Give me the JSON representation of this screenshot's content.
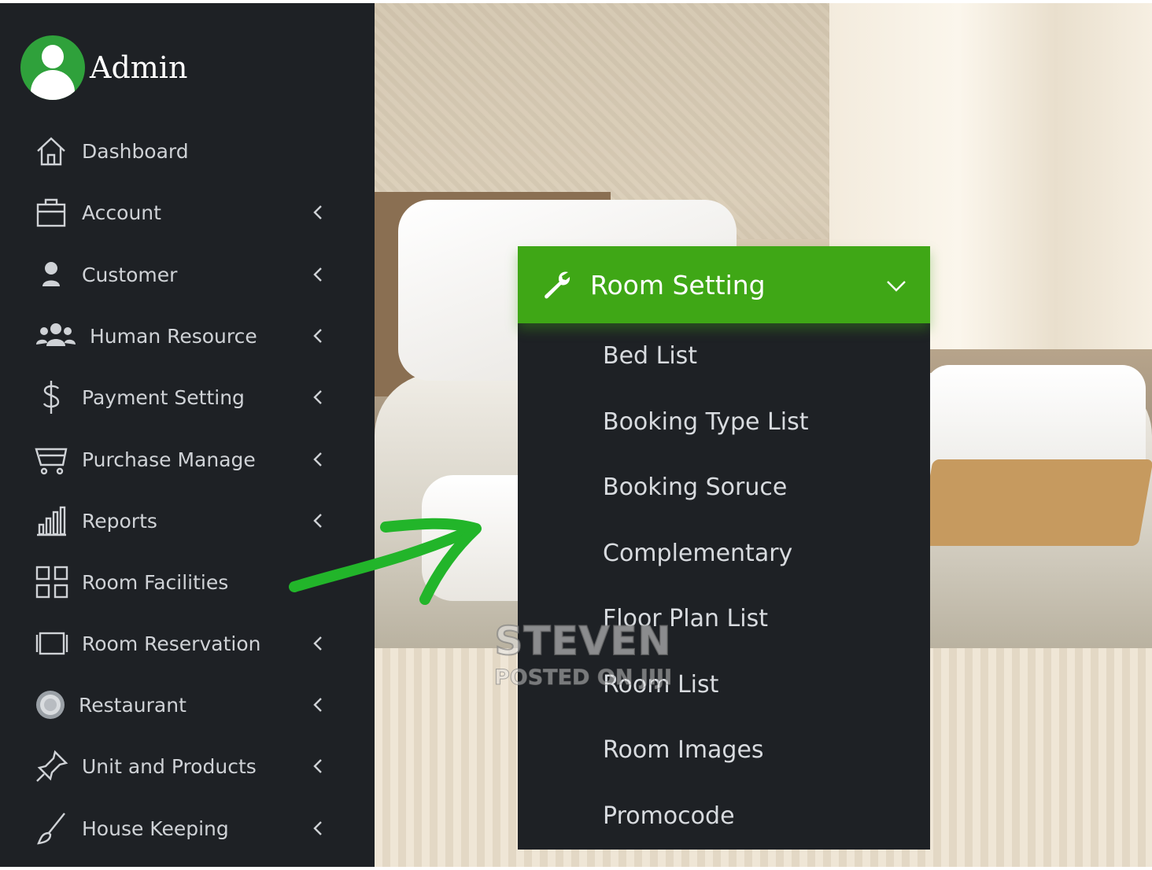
{
  "admin": {
    "name": "Admin"
  },
  "sidebar": {
    "items": [
      {
        "label": "Dashboard",
        "icon": "home-icon",
        "has_submenu": false
      },
      {
        "label": "Account",
        "icon": "briefcase-icon",
        "has_submenu": true
      },
      {
        "label": "Customer",
        "icon": "user-icon",
        "has_submenu": true
      },
      {
        "label": "Human Resource",
        "icon": "users-icon",
        "has_submenu": true
      },
      {
        "label": "Payment Setting",
        "icon": "dollar-icon",
        "has_submenu": true
      },
      {
        "label": "Purchase Manage",
        "icon": "cart-icon",
        "has_submenu": true
      },
      {
        "label": "Reports",
        "icon": "bar-chart-icon",
        "has_submenu": true
      },
      {
        "label": "Room Facilities",
        "icon": "grid-icon",
        "has_submenu": false
      },
      {
        "label": "Room Reservation",
        "icon": "panel-icon",
        "has_submenu": true
      },
      {
        "label": "Restaurant",
        "icon": "plate-icon",
        "has_submenu": true
      },
      {
        "label": "Unit and Products",
        "icon": "pin-icon",
        "has_submenu": true
      },
      {
        "label": "House Keeping",
        "icon": "brush-icon",
        "has_submenu": true
      }
    ]
  },
  "room_setting": {
    "title": "Room Setting",
    "items": [
      "Bed List",
      "Booking Type List",
      "Booking Soruce",
      "Complementary",
      "Floor Plan List",
      "Room List",
      "Room Images",
      "Promocode"
    ]
  },
  "watermark": {
    "line1": "STEVEN",
    "line2": "POSTED ON JIJI"
  },
  "colors": {
    "sidebar_bg": "#1e2125",
    "accent_green": "#3fa716",
    "arrow_green": "#22b52a",
    "text": "#cfd2d6"
  }
}
